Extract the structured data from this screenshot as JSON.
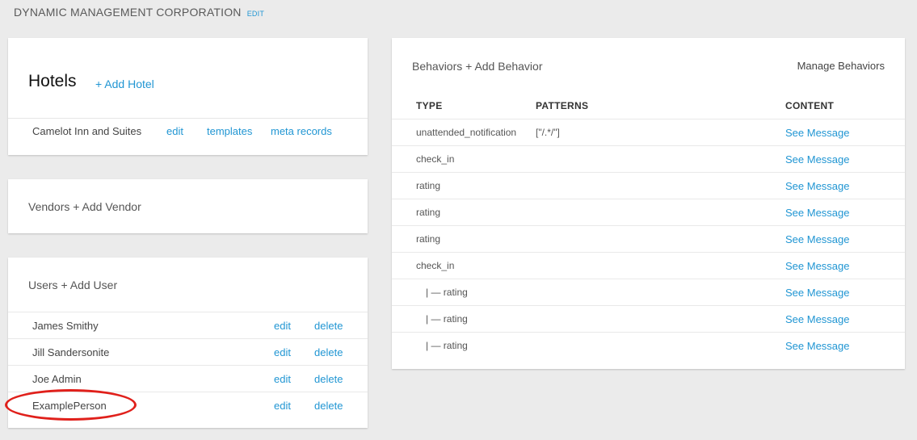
{
  "org": {
    "name": "DYNAMIC MANAGEMENT CORPORATION",
    "edit_label": "EDIT"
  },
  "hotels": {
    "title": "Hotels",
    "add_label": "+ Add Hotel",
    "items": [
      {
        "name": "Camelot Inn and Suites",
        "edit": "edit",
        "templates": "templates",
        "meta": "meta records"
      }
    ]
  },
  "vendors": {
    "title": "Vendors + Add Vendor"
  },
  "users": {
    "title": "Users + Add User",
    "items": [
      {
        "name": "James Smithy",
        "edit": "edit",
        "delete": "delete"
      },
      {
        "name": "Jill Sandersonite",
        "edit": "edit",
        "delete": "delete"
      },
      {
        "name": "Joe Admin",
        "edit": "edit",
        "delete": "delete"
      },
      {
        "name": "ExamplePerson",
        "edit": "edit",
        "delete": "delete"
      }
    ]
  },
  "behaviors": {
    "title": "Behaviors + Add Behavior",
    "manage_label": "Manage Behaviors",
    "columns": [
      "TYPE",
      "PATTERNS",
      "CONTENT"
    ],
    "rows": [
      {
        "type": "unattended_notification",
        "pattern": "[\"/.*/\"]",
        "content": "See Message"
      },
      {
        "type": "check_in",
        "pattern": "",
        "content": "See Message"
      },
      {
        "type": "rating",
        "pattern": "",
        "content": "See Message"
      },
      {
        "type": "rating",
        "pattern": "",
        "content": "See Message"
      },
      {
        "type": "rating",
        "pattern": "",
        "content": "See Message"
      },
      {
        "type": "check_in",
        "pattern": "",
        "content": "See Message"
      },
      {
        "type": "| — rating",
        "pattern": "",
        "content": "See Message"
      },
      {
        "type": "| — rating",
        "pattern": "",
        "content": "See Message"
      },
      {
        "type": "| — rating",
        "pattern": "",
        "content": "See Message"
      }
    ]
  },
  "colors": {
    "link": "#2196d3",
    "highlight": "#e0201b",
    "background": "#ebebeb"
  }
}
